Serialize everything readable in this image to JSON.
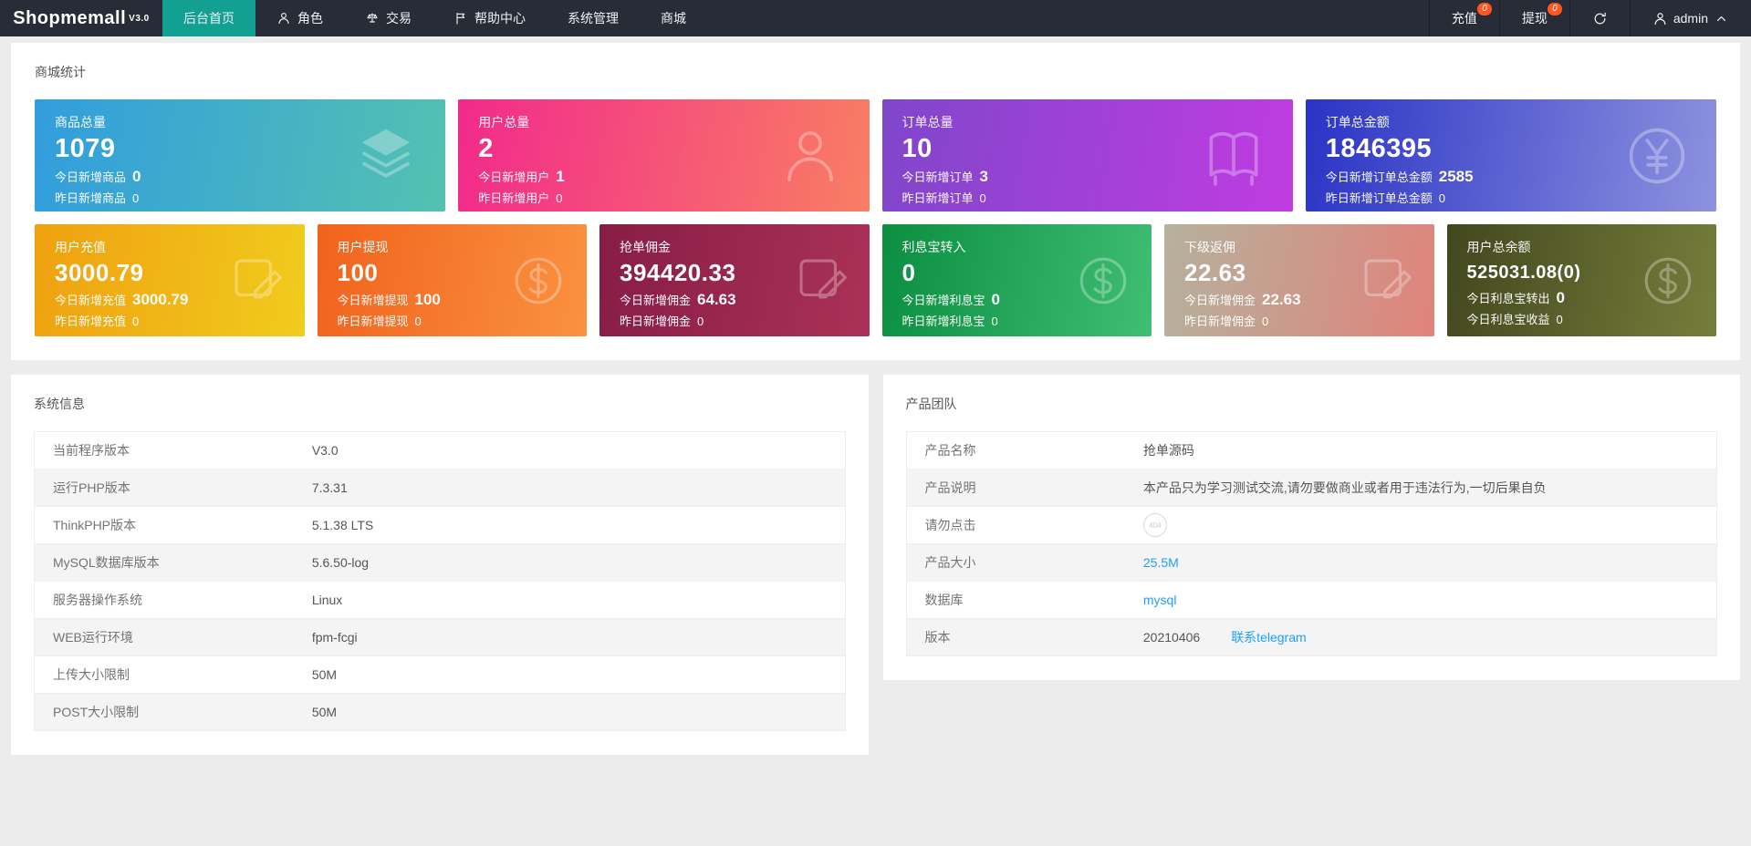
{
  "navbar": {
    "logo": "Shopmemall",
    "logo_version": "V3.0",
    "menu": [
      {
        "label": "后台首页",
        "icon": null,
        "active": true
      },
      {
        "label": "角色",
        "icon": "person-icon",
        "active": false
      },
      {
        "label": "交易",
        "icon": "scales-icon",
        "active": false
      },
      {
        "label": "帮助中心",
        "icon": "flag-icon",
        "active": false
      },
      {
        "label": "系统管理",
        "icon": null,
        "active": false
      },
      {
        "label": "商城",
        "icon": null,
        "active": false
      }
    ],
    "recharge": {
      "label": "充值",
      "badge": "0"
    },
    "withdraw": {
      "label": "提现",
      "badge": "0"
    },
    "user": {
      "name": "admin"
    }
  },
  "stats_panel": {
    "title": "商城统计",
    "cards_row1": [
      {
        "title": "商品总量",
        "value": "1079",
        "today_label": "今日新增商品",
        "today_value": "0",
        "yesterday_label": "昨日新增商品",
        "yesterday_value": "0",
        "icon": "layers-icon",
        "gradient": [
          "#319dde",
          "#54c1b1"
        ]
      },
      {
        "title": "用户总量",
        "value": "2",
        "today_label": "今日新增用户",
        "today_value": "1",
        "yesterday_label": "昨日新增用户",
        "yesterday_value": "0",
        "icon": "person-icon",
        "gradient": [
          "#f2298c",
          "#f97e63"
        ]
      },
      {
        "title": "订单总量",
        "value": "10",
        "today_label": "今日新增订单",
        "today_value": "3",
        "yesterday_label": "昨日新增订单",
        "yesterday_value": "0",
        "icon": "book-icon",
        "gradient": [
          "#7f46ca",
          "#c03ce1"
        ]
      },
      {
        "title": "订单总金额",
        "value": "1846395",
        "today_label": "今日新增订单总金额",
        "today_value": "2585",
        "yesterday_label": "昨日新增订单总金额",
        "yesterday_value": "0",
        "icon": "yen-circle-icon",
        "gradient": [
          "#2a33c5",
          "#8d92de"
        ]
      }
    ],
    "cards_row2": [
      {
        "title": "用户充值",
        "value": "3000.79",
        "today_label": "今日新增充值",
        "today_value": "3000.79",
        "yesterday_label": "昨日新增充值",
        "yesterday_value": "0",
        "icon": "edit-square-icon",
        "gradient": [
          "#efa010",
          "#f1cc1d"
        ]
      },
      {
        "title": "用户提现",
        "value": "100",
        "today_label": "今日新增提现",
        "today_value": "100",
        "yesterday_label": "昨日新增提现",
        "yesterday_value": "0",
        "icon": "dollar-circle-icon",
        "gradient": [
          "#f1621d",
          "#fa9240"
        ]
      },
      {
        "title": "抢单佣金",
        "value": "394420.33",
        "today_label": "今日新增佣金",
        "today_value": "64.63",
        "yesterday_label": "昨日新增佣金",
        "yesterday_value": "0",
        "icon": "edit-square-icon",
        "gradient": [
          "#871d44",
          "#ab3158"
        ]
      },
      {
        "title": "利息宝转入",
        "value": "0",
        "today_label": "今日新增利息宝",
        "today_value": "0",
        "yesterday_label": "昨日新增利息宝",
        "yesterday_value": "0",
        "icon": "dollar-circle-icon",
        "gradient": [
          "#0b8e40",
          "#3fbe74"
        ]
      },
      {
        "title": "下级返佣",
        "value": "22.63",
        "today_label": "今日新增佣金",
        "today_value": "22.63",
        "yesterday_label": "昨日新增佣金",
        "yesterday_value": "0",
        "icon": "edit-square-icon",
        "gradient": [
          "#b5b19d",
          "#e0837a"
        ]
      },
      {
        "title": "用户总余额",
        "value": "525031.08(0)",
        "today_label": "今日利息宝转出",
        "today_value": "0",
        "yesterday_label": "今日利息宝收益",
        "yesterday_value": "0",
        "icon": "dollar-circle-icon",
        "gradient": [
          "#42471e",
          "#757e3b"
        ]
      }
    ]
  },
  "system_info": {
    "title": "系统信息",
    "rows": [
      {
        "label": "当前程序版本",
        "value": "V3.0",
        "type": "text"
      },
      {
        "label": "运行PHP版本",
        "value": "7.3.31",
        "type": "text"
      },
      {
        "label": "ThinkPHP版本",
        "value": "5.1.38 LTS",
        "type": "text"
      },
      {
        "label": "MySQL数据库版本",
        "value": "5.6.50-log",
        "type": "text"
      },
      {
        "label": "服务器操作系统",
        "value": "Linux",
        "type": "text"
      },
      {
        "label": "WEB运行环境",
        "value": "fpm-fcgi",
        "type": "text"
      },
      {
        "label": "上传大小限制",
        "value": "50M",
        "type": "text"
      },
      {
        "label": "POST大小限制",
        "value": "50M",
        "type": "text"
      }
    ]
  },
  "product_team": {
    "title": "产品团队",
    "rows": [
      {
        "label": "产品名称",
        "value": "抢单源码",
        "type": "text"
      },
      {
        "label": "产品说明",
        "value": "本产品只为学习测试交流,请勿要做商业或者用于违法行为,一切后果自负",
        "type": "text"
      },
      {
        "label": "请勿点击",
        "value": "404",
        "type": "badge"
      },
      {
        "label": "产品大小",
        "value": "25.5M",
        "type": "link"
      },
      {
        "label": "数据库",
        "value": "mysql",
        "type": "link"
      },
      {
        "label": "版本",
        "value": "20210406",
        "type": "text",
        "extra_link": "联系telegram"
      }
    ]
  },
  "colors": {
    "accent_teal": "#12a093",
    "badge_orange": "#ff5722",
    "link_blue": "#1e9fff"
  }
}
